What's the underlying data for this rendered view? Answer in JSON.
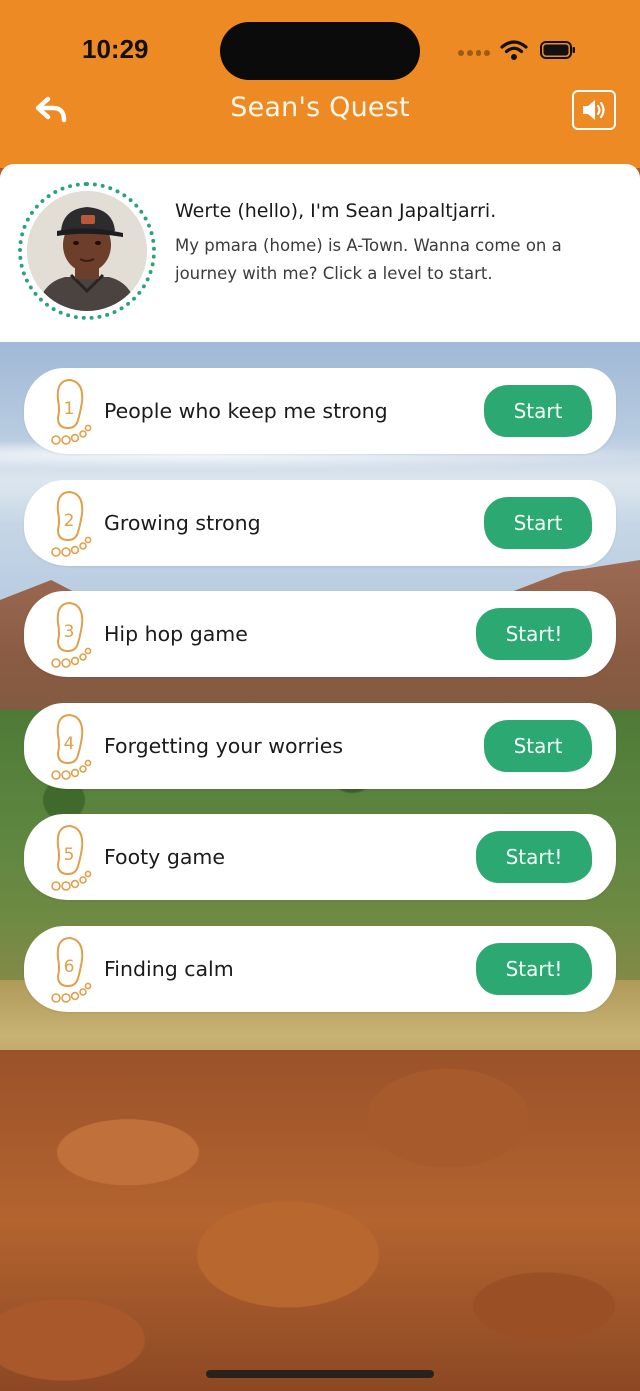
{
  "status_bar": {
    "time": "10:29"
  },
  "nav": {
    "title": "Sean's Quest",
    "back_icon": "back-arrow-icon",
    "sound_icon": "speaker-icon"
  },
  "intro": {
    "greeting": "Werte (hello), I'm Sean Japaltjarri.",
    "text": "My pmara (home) is A-Town. Wanna come on a journey with me? Click a level to start."
  },
  "levels": [
    {
      "number": "1",
      "title": "People who keep me strong",
      "button": "Start"
    },
    {
      "number": "2",
      "title": "Growing strong",
      "button": "Start"
    },
    {
      "number": "3",
      "title": "Hip hop game",
      "button": "Start!"
    },
    {
      "number": "4",
      "title": "Forgetting your worries",
      "button": "Start"
    },
    {
      "number": "5",
      "title": "Footy game",
      "button": "Start!"
    },
    {
      "number": "6",
      "title": "Finding calm",
      "button": "Start!"
    }
  ],
  "colors": {
    "header": "#ee8a23",
    "button": "#2ca873",
    "avatar_ring": "#2aa37a",
    "footprint": "#e0a04a"
  }
}
